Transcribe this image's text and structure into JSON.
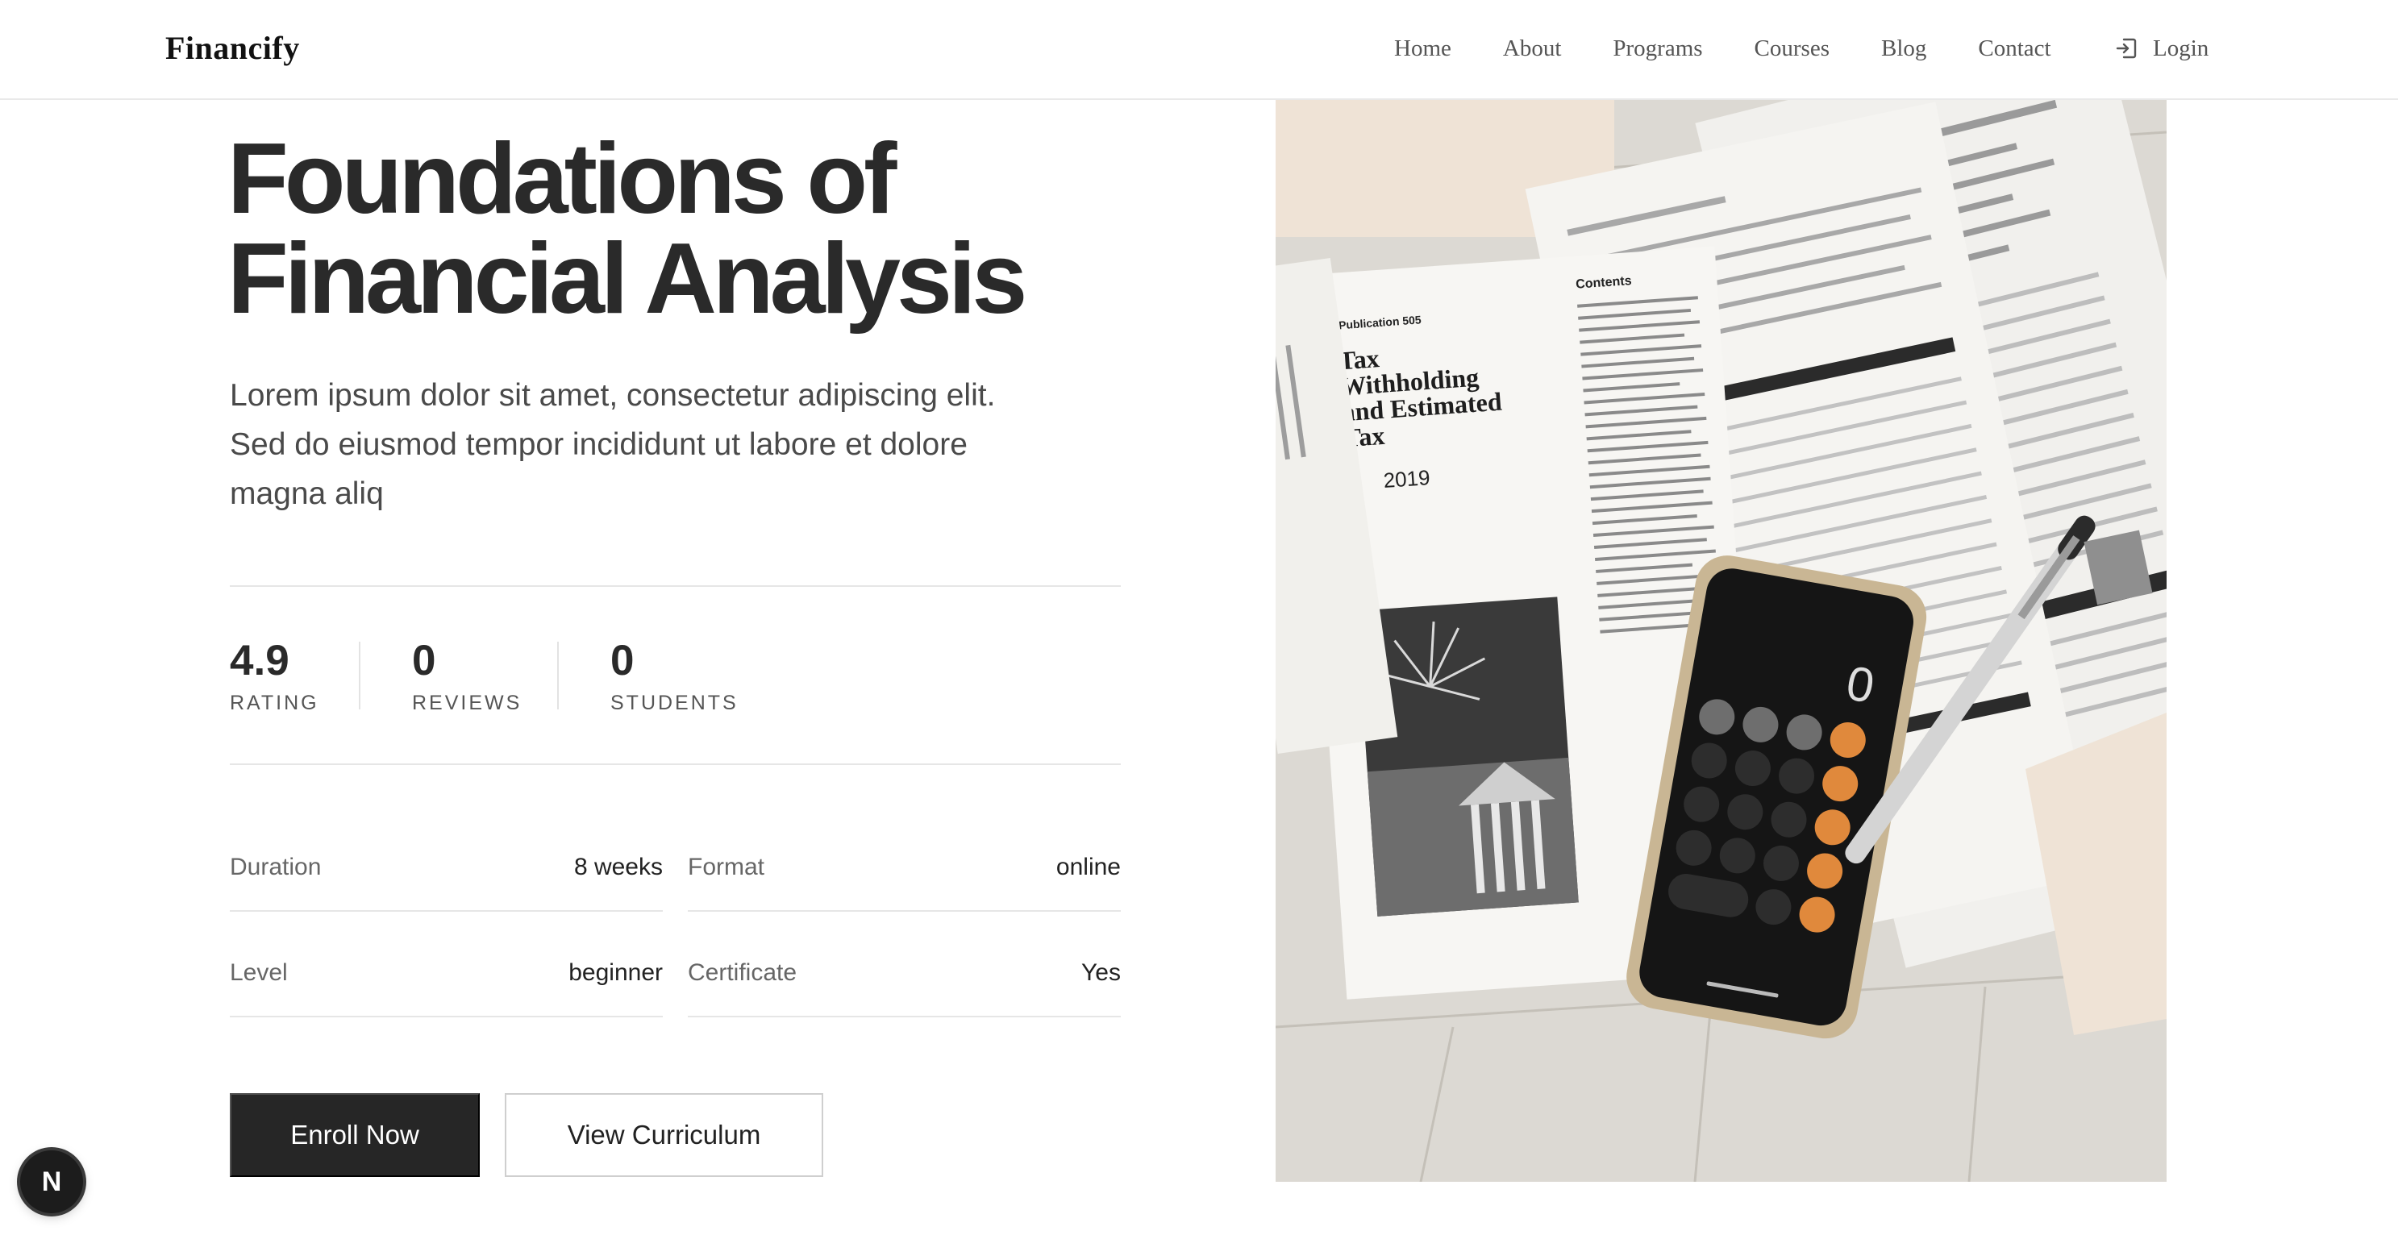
{
  "brand": "Financify",
  "nav": {
    "links": [
      "Home",
      "About",
      "Programs",
      "Courses",
      "Blog",
      "Contact"
    ],
    "login_label": "Login",
    "login_icon": "login-icon"
  },
  "hero": {
    "title_line1": "Foundations of",
    "title_line2": "Financial Analysis",
    "description": "Lorem ipsum dolor sit amet, consectetur adipiscing elit. Sed do eiusmod tempor incididunt ut labore et dolore magna aliq",
    "stats": [
      {
        "value": "4.9",
        "label": "RATING"
      },
      {
        "value": "0",
        "label": "REVIEWS"
      },
      {
        "value": "0",
        "label": "STUDENTS"
      }
    ],
    "details": [
      {
        "label": "Duration",
        "value": "8 weeks"
      },
      {
        "label": "Format",
        "value": "online"
      },
      {
        "label": "Level",
        "value": "beginner"
      },
      {
        "label": "Certificate",
        "value": "Yes"
      }
    ],
    "primary_button": "Enroll Now",
    "secondary_button": "View Curriculum"
  },
  "image_text": {
    "publication": "Publication 505",
    "heading_line1": "Tax",
    "heading_line2": "Withholding",
    "heading_line3": "and Estimated",
    "heading_line4": "Tax",
    "year": "2019",
    "contents": "Contents",
    "calculator_display": "0"
  },
  "dev_badge": {
    "letter": "N"
  },
  "colors": {
    "primary_button_bg": "#262626",
    "text_dark": "#2a2a2a",
    "divider": "#e6e6e6"
  }
}
